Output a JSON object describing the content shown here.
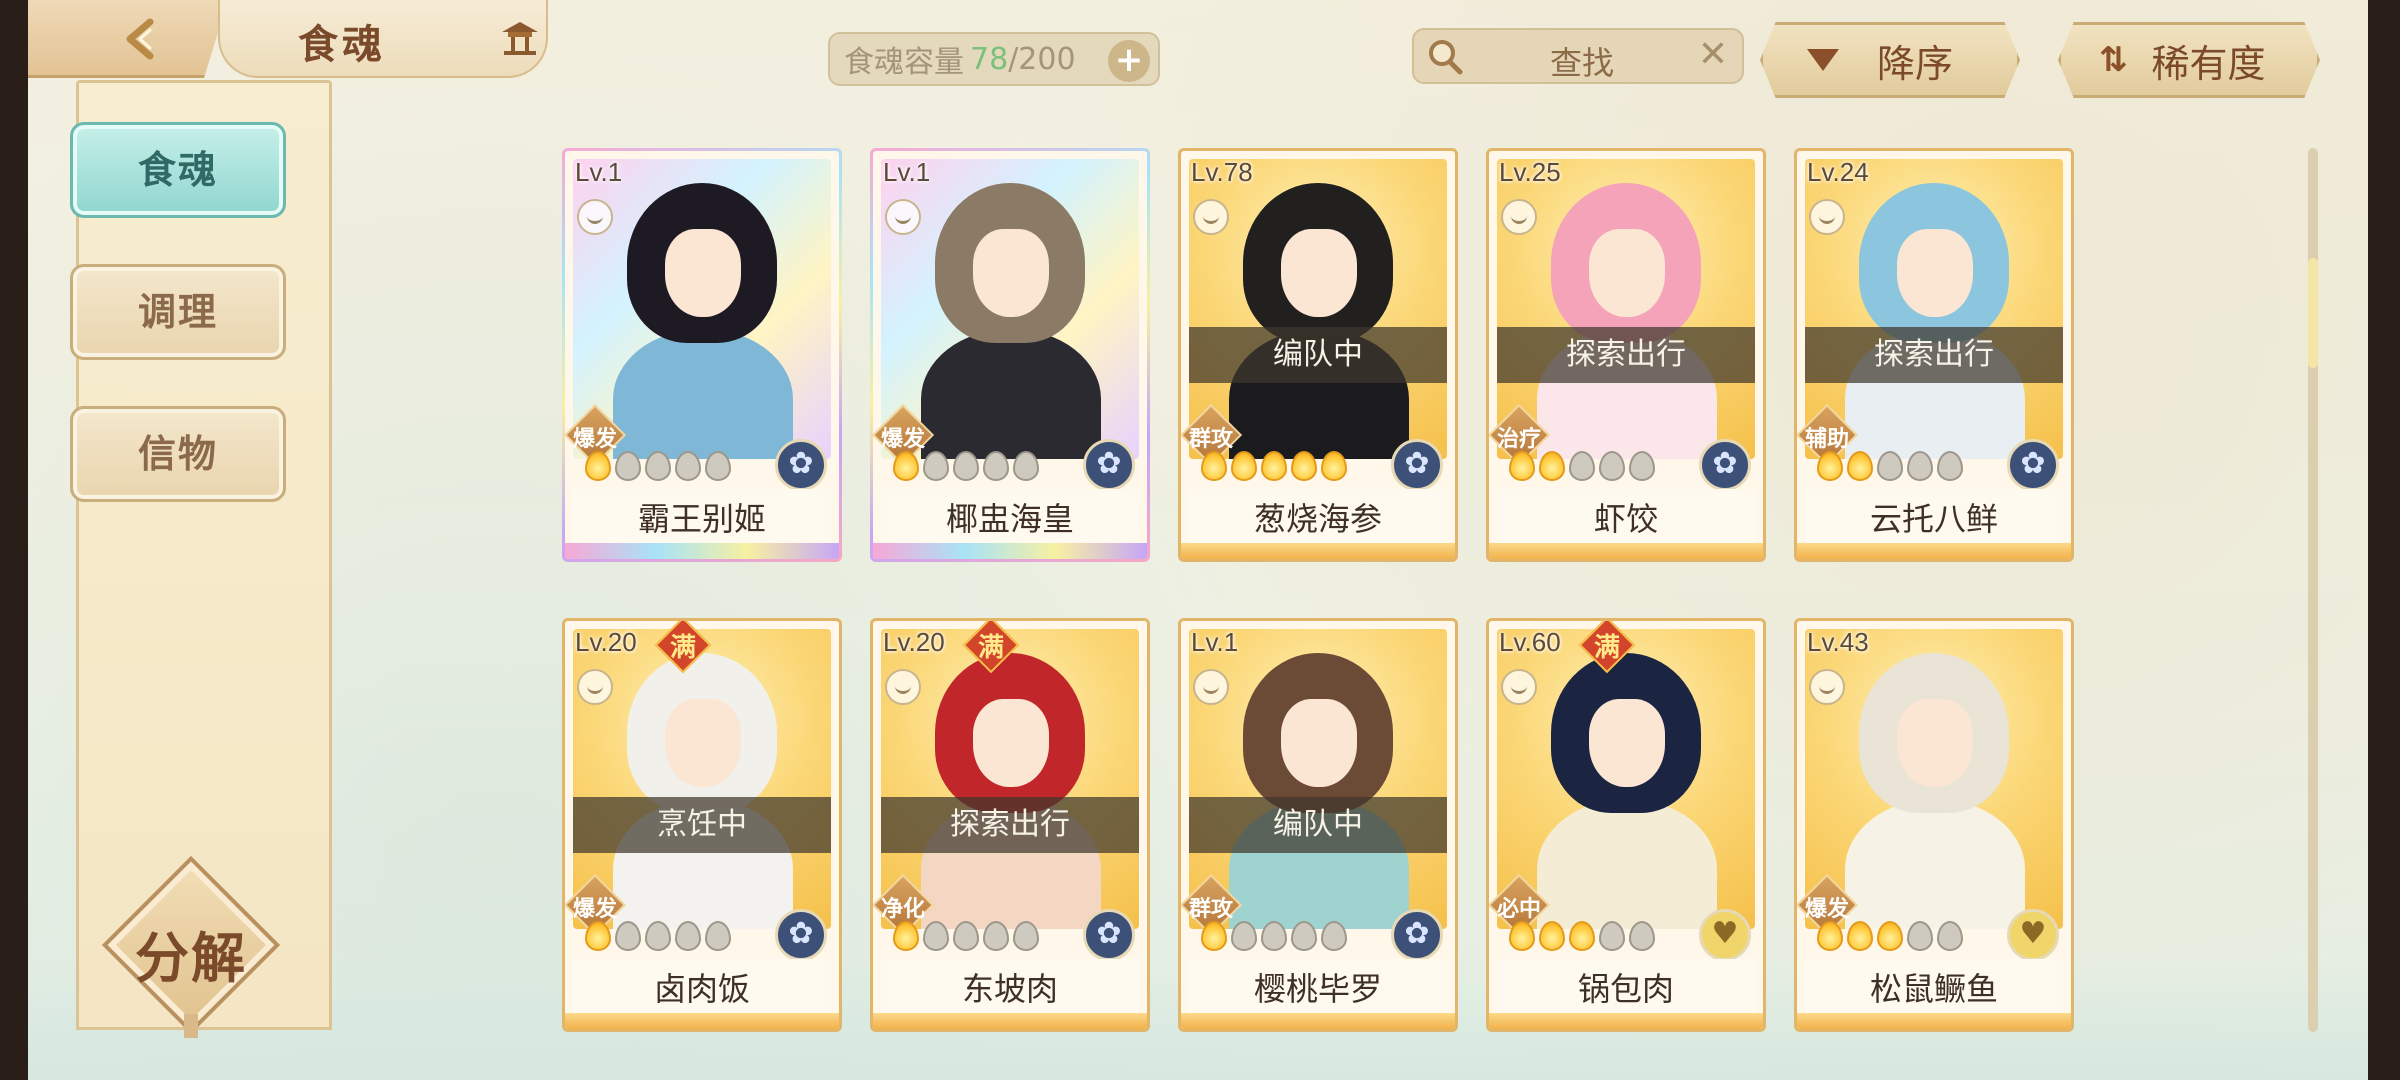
{
  "header": {
    "title": "食魂",
    "capacity_label": "食魂容量",
    "capacity_current": "78",
    "capacity_max": "/200",
    "plus": "+",
    "search_text": "查找",
    "search_clear": "✕",
    "sort_order_label": "降序",
    "sort_field_label": "稀有度",
    "sort_field_icon": "⇅"
  },
  "sidebar": {
    "items": [
      {
        "label": "食魂",
        "active": true
      },
      {
        "label": "调理",
        "active": false
      },
      {
        "label": "信物",
        "active": false
      }
    ],
    "decompose_label": "分解"
  },
  "cards": [
    {
      "level": "Lv.1",
      "name": "霸王别姬",
      "role": "爆发",
      "status": "",
      "stars": 1,
      "max": false,
      "rarity": "rainbow",
      "element": "blue",
      "hair": "#1e1a24",
      "outfit": "#7fb7d6"
    },
    {
      "level": "Lv.1",
      "name": "椰盅海皇",
      "role": "爆发",
      "status": "",
      "stars": 1,
      "max": false,
      "rarity": "rainbow",
      "element": "blue",
      "hair": "#8a7a66",
      "outfit": "#2b2a30"
    },
    {
      "level": "Lv.78",
      "name": "葱烧海参",
      "role": "群攻",
      "status": "编队中",
      "stars": 5,
      "max": false,
      "rarity": "gold",
      "element": "blue",
      "hair": "#22201f",
      "outfit": "#1b1b1e"
    },
    {
      "level": "Lv.25",
      "name": "虾饺",
      "role": "治疗",
      "status": "探索出行",
      "stars": 2,
      "max": false,
      "rarity": "gold",
      "element": "blue",
      "hair": "#f4a3b8",
      "outfit": "#fbe6ea"
    },
    {
      "level": "Lv.24",
      "name": "云托八鲜",
      "role": "辅助",
      "status": "探索出行",
      "stars": 2,
      "max": false,
      "rarity": "gold",
      "element": "blue",
      "hair": "#8cc5de",
      "outfit": "#e8eef2"
    },
    {
      "level": "Lv.20",
      "name": "卤肉饭",
      "role": "爆发",
      "status": "烹饪中",
      "stars": 1,
      "max": true,
      "rarity": "gold",
      "element": "blue",
      "hair": "#f2f0ea",
      "outfit": "#f4f2ee"
    },
    {
      "level": "Lv.20",
      "name": "东坡肉",
      "role": "净化",
      "status": "探索出行",
      "stars": 1,
      "max": true,
      "rarity": "gold",
      "element": "blue",
      "hair": "#c1272a",
      "outfit": "#f4d7c2"
    },
    {
      "level": "Lv.1",
      "name": "樱桃毕罗",
      "role": "群攻",
      "status": "编队中",
      "stars": 1,
      "max": false,
      "rarity": "gold",
      "element": "blue",
      "hair": "#6b4a36",
      "outfit": "#9fd3cf"
    },
    {
      "level": "Lv.60",
      "name": "锅包肉",
      "role": "必中",
      "status": "",
      "stars": 3,
      "max": true,
      "rarity": "gold",
      "element": "gold",
      "hair": "#1b2440",
      "outfit": "#f5ecd6"
    },
    {
      "level": "Lv.43",
      "name": "松鼠鳜鱼",
      "role": "爆发",
      "status": "",
      "stars": 3,
      "max": false,
      "rarity": "gold",
      "element": "gold",
      "hair": "#e9e4d6",
      "outfit": "#f7f2e6"
    }
  ],
  "max_badge": "满"
}
